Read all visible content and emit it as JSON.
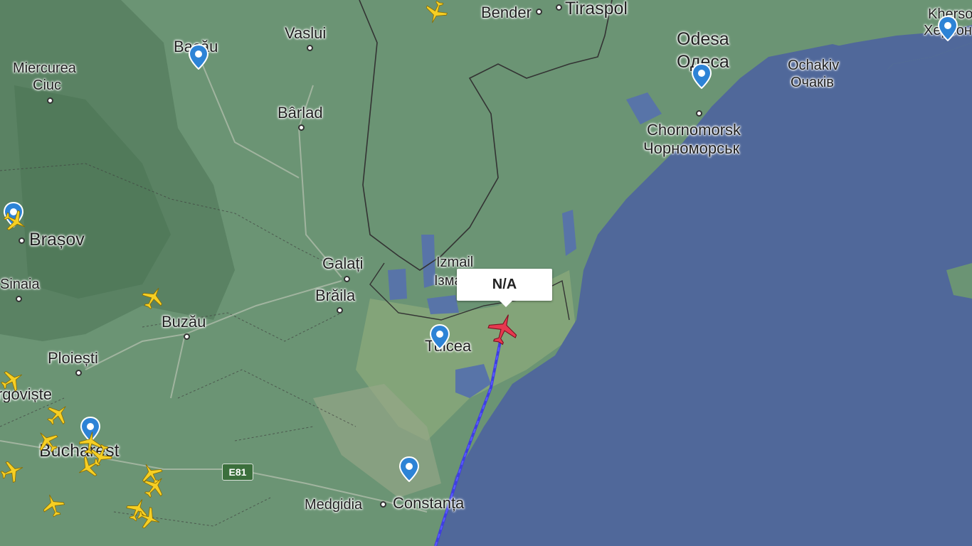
{
  "map": {
    "colors": {
      "land": "#6b9474",
      "land_dark": "#4f7a5a",
      "sea": "#50689a",
      "lake": "#5874a8",
      "plane_yellow": "#f6cf24",
      "plane_selected": "#e7394f",
      "track": "#3f3fe0",
      "pin": "#2d83d6"
    },
    "cities": [
      {
        "name": "Bender"
      },
      {
        "name": "Tiraspol"
      },
      {
        "name": "Vaslui"
      },
      {
        "name": "Bacău"
      },
      {
        "name": "Miercurea"
      },
      {
        "name": "Ciuc"
      },
      {
        "name": "Bârlad"
      },
      {
        "name": "Odesa"
      },
      {
        "name": "Одеса"
      },
      {
        "name": "Ochakiv"
      },
      {
        "name": "Очаків"
      },
      {
        "name": "Kherson"
      },
      {
        "name": "Херсон"
      },
      {
        "name": "Chornomorsk"
      },
      {
        "name": "Чорноморськ"
      },
      {
        "name": "Brașov"
      },
      {
        "name": "Sinaia"
      },
      {
        "name": "Galați"
      },
      {
        "name": "Izmail"
      },
      {
        "name": "Ізмаїл"
      },
      {
        "name": "Brăila"
      },
      {
        "name": "Buzău"
      },
      {
        "name": "Tulcea"
      },
      {
        "name": "Ploiești"
      },
      {
        "name": "Târgoviște"
      },
      {
        "name": "Bucharest"
      },
      {
        "name": "Medgidia"
      },
      {
        "name": "Constanța"
      }
    ],
    "road_label": "E81",
    "selected_flight": {
      "callsign": "N/A"
    },
    "icons": [
      "airport-pin-icon",
      "aircraft-icon",
      "selected-aircraft-icon"
    ]
  }
}
